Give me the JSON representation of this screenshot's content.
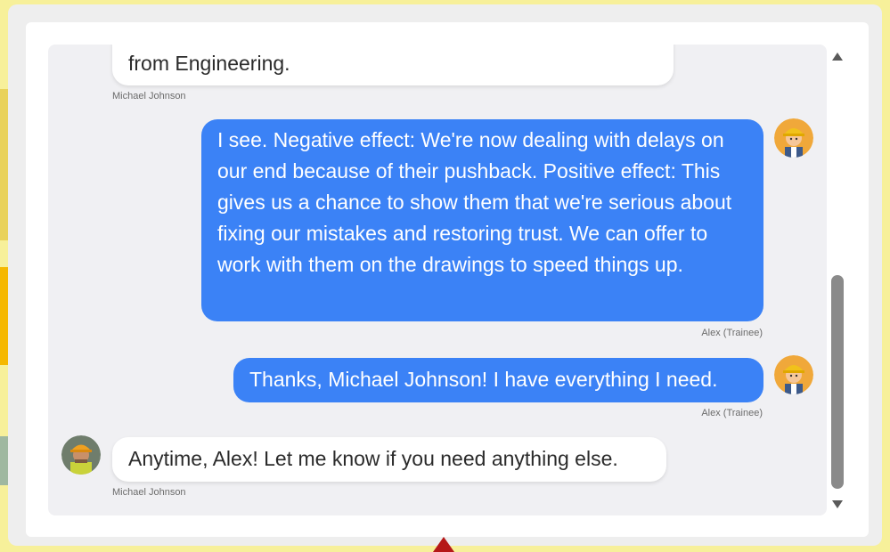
{
  "chat": {
    "messages": [
      {
        "sender": "Michael Johnson",
        "side": "left",
        "text": "from Engineering."
      },
      {
        "sender": "Alex (Trainee)",
        "side": "right",
        "text": "I see. Negative effect: We're now dealing with delays on our end because of their pushback. Positive effect: This gives us a chance to show them that we're serious about fixing our mistakes and restoring trust. We can offer to work with them on the drawings to speed things up."
      },
      {
        "sender": "Alex (Trainee)",
        "side": "right",
        "text": "Thanks, Michael Johnson! I have everything I need."
      },
      {
        "sender": "Michael Johnson",
        "side": "left",
        "text": "Anytime, Alex! Let me know if you need anything else."
      }
    ]
  },
  "scrollbar": {
    "up_icon": "triangle-up",
    "down_icon": "triangle-down"
  },
  "colors": {
    "user_bubble": "#3b82f6",
    "other_bubble": "#ffffff",
    "chat_bg": "#f0f0f3",
    "pointer": "#b51818"
  }
}
